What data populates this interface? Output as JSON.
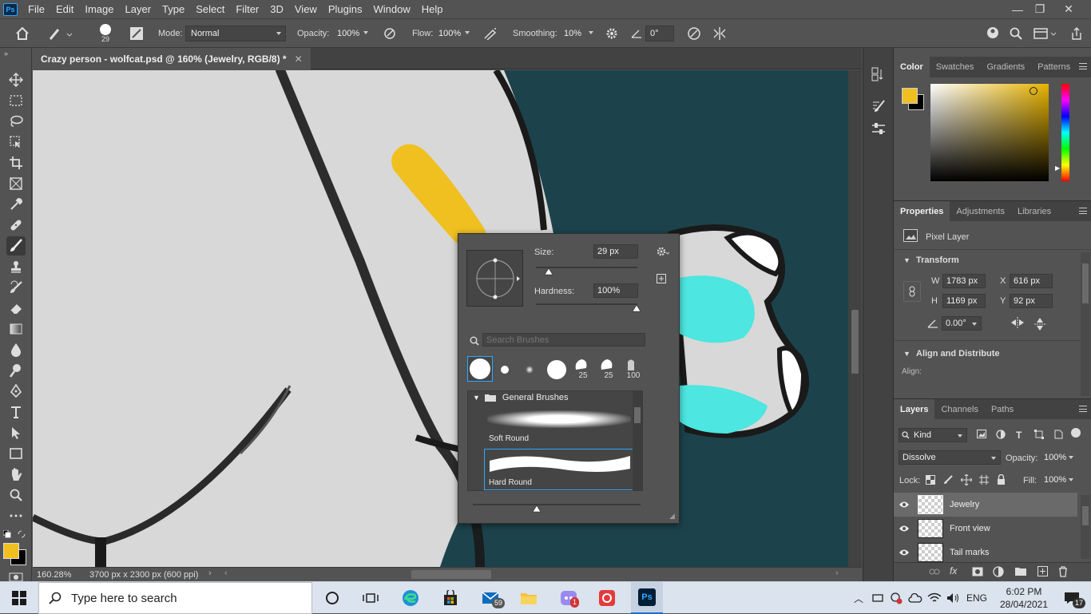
{
  "app": {
    "logo": "Ps"
  },
  "menu": [
    "File",
    "Edit",
    "Image",
    "Layer",
    "Type",
    "Select",
    "Filter",
    "3D",
    "View",
    "Plugins",
    "Window",
    "Help"
  ],
  "options": {
    "brush_size": "29",
    "mode_label": "Mode:",
    "mode_value": "Normal",
    "opacity_label": "Opacity:",
    "opacity_value": "100%",
    "flow_label": "Flow:",
    "flow_value": "100%",
    "smoothing_label": "Smoothing:",
    "smoothing_value": "10%",
    "angle_value": "0°"
  },
  "document": {
    "tab_title": "Crazy person - wolfcat.psd @ 160% (Jewelry, RGB/8) *",
    "zoom": "160.28%",
    "dimensions": "3700 px x 2300 px (600 ppi)"
  },
  "brush_popup": {
    "size_label": "Size:",
    "size_value": "29 px",
    "hardness_label": "Hardness:",
    "hardness_value": "100%",
    "search_placeholder": "Search Brushes",
    "preset_sizes": [
      "25",
      "25",
      "100"
    ],
    "group_name": "General Brushes",
    "brushes": [
      "Soft Round",
      "Hard Round"
    ]
  },
  "color_panel": {
    "tabs": [
      "Color",
      "Swatches",
      "Gradients",
      "Patterns"
    ],
    "foreground": "#f0c020",
    "background": "#000000"
  },
  "properties_panel": {
    "tabs": [
      "Properties",
      "Adjustments",
      "Libraries"
    ],
    "kind": "Pixel Layer",
    "transform_label": "Transform",
    "w_label": "W",
    "w_value": "1783 px",
    "h_label": "H",
    "h_value": "1169 px",
    "x_label": "X",
    "x_value": "616 px",
    "y_label": "Y",
    "y_value": "92 px",
    "angle_value": "0.00°",
    "align_label": "Align and Distribute",
    "align_sub": "Align:"
  },
  "layers_panel": {
    "tabs": [
      "Layers",
      "Channels",
      "Paths"
    ],
    "filter_kind": "Kind",
    "blend_mode": "Dissolve",
    "opacity_label": "Opacity:",
    "opacity_value": "100%",
    "lock_label": "Lock:",
    "fill_label": "Fill:",
    "fill_value": "100%",
    "layers": [
      "Jewelry",
      "Front view",
      "Tail marks"
    ]
  },
  "taskbar": {
    "search_placeholder": "Type here to search",
    "mail_badge": "59",
    "discord_badge": "1",
    "language": "ENG",
    "time": "6:02 PM",
    "date": "28/04/2021",
    "notif_count": "17"
  }
}
